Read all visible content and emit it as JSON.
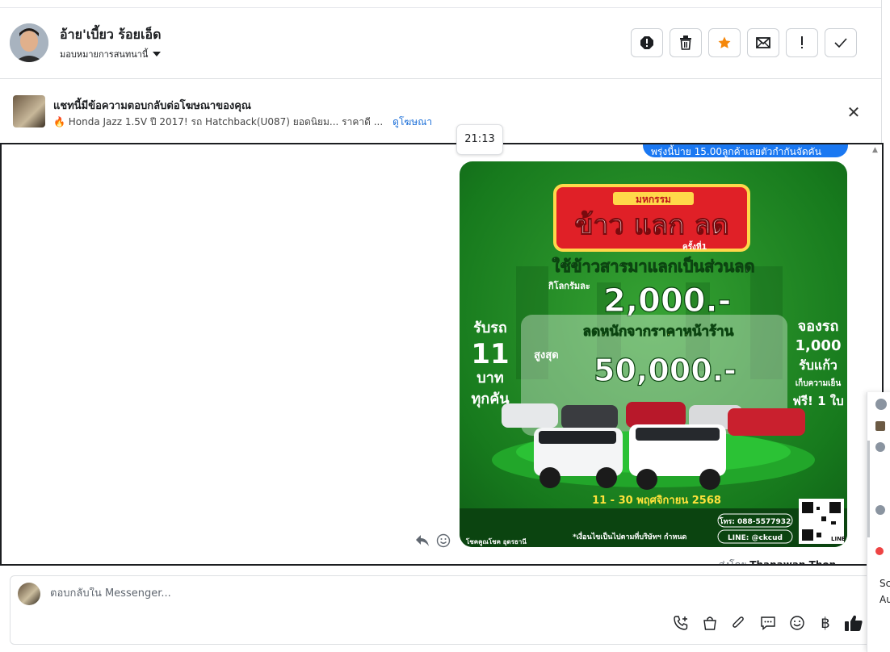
{
  "header": {
    "contact_name": "อ้าย'เบี้ยว ร้อยเอ็ด",
    "assign_label": "มอบหมายการสนทนานี้",
    "actions": [
      "spam-icon",
      "trash-icon",
      "star-icon",
      "mail-icon",
      "important-icon",
      "check-icon"
    ],
    "star_color": "#f5870a"
  },
  "ad": {
    "title": "แชทนี้มีข้อความตอบกลับต่อโฆษณาของคุณ",
    "description": "🔥 Honda Jazz 1.5V ปี 2017! รถ Hatchback(U087) ยอดนิยม... ราคาดี ...",
    "link": "ดูโฆษณา"
  },
  "conversation": {
    "timestamp": "21:13",
    "sent_bubble_text": "พรุ่งนี้บ่าย 15.00ลูกค้าเลยตัวกำกันจัดคัน",
    "bubble_color": "#1a78f2",
    "sent_by_label": "ส่งโดย",
    "sent_by_name": "Thanawan Thon"
  },
  "promo": {
    "headline_small": "มหกรรม",
    "headline": "ข้าว แลก ลด",
    "round": "ครั้งที่1",
    "line1": "ใช้ข้าวสารมาแลกเป็นส่วนลด",
    "per_kg": "กิโลกรัมละ",
    "amount1": "2,000.-",
    "left_1": "รับรถ",
    "left_2": "11",
    "left_3": "บาท",
    "left_4": "ทุกคัน",
    "right_1": "จองรถ",
    "right_2": "1,000",
    "right_3": "รับแก้ว",
    "right_4": "เก็บความเย็น",
    "right_5": "ฟรี! 1 ใบ",
    "line2": "ลดหนักจากราคาหน้าร้าน",
    "max_label": "สูงสุด",
    "amount2": "50,000.-",
    "dates": "11 - 30 พฤศจิกายน 2568",
    "phone": "โทร: 088-5577932",
    "line_id": "LINE: @ckcud",
    "condition": "*เงื่อนไขเป็นไปตามที่บริษัทฯ กำหนด",
    "dealer": "โชคคูณโชค อุดรธานี",
    "qr_label": "LINE"
  },
  "composer": {
    "placeholder": "ตอบกลับใน Messenger...",
    "tools": [
      "call-add-icon",
      "shopping-bag-icon",
      "attachment-icon",
      "saved-reply-icon",
      "emoji-icon",
      "baht-icon",
      "like-icon"
    ]
  },
  "side_panel": {
    "text_1": "Sc",
    "text_2": "Au"
  }
}
